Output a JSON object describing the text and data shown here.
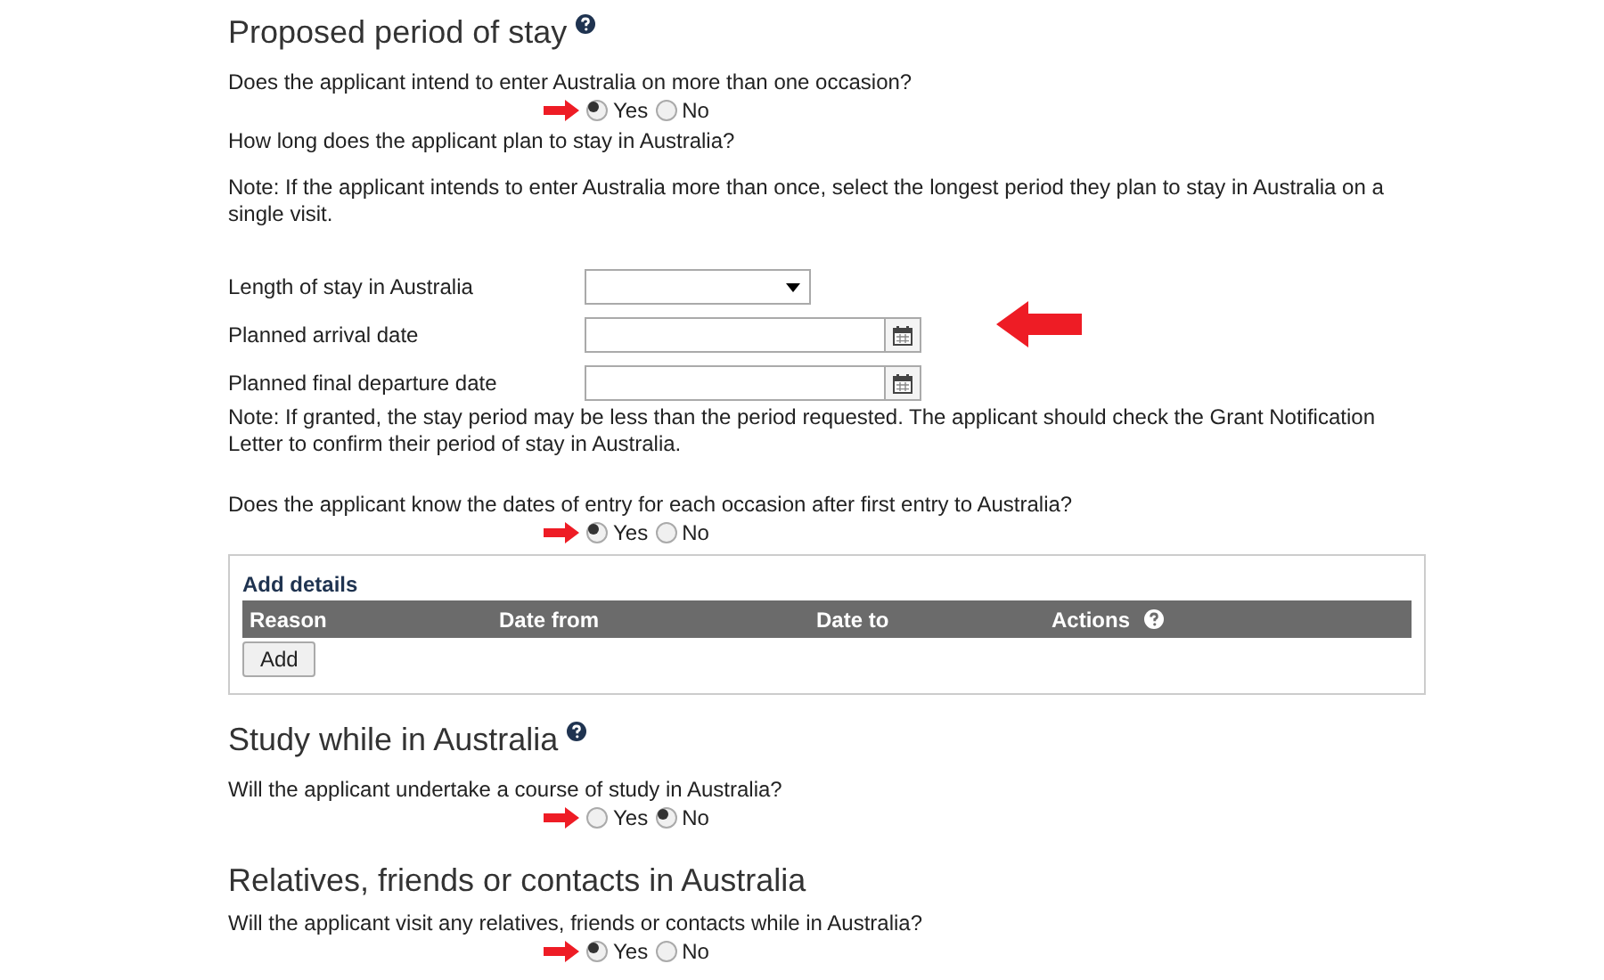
{
  "sections": [
    {
      "title": "Proposed period of stay",
      "help": true,
      "items": [
        {
          "kind": "question",
          "text": "Does the applicant intend to enter Australia on more than one occasion?"
        },
        {
          "kind": "radio",
          "options": [
            {
              "label": "Yes",
              "selected": true
            },
            {
              "label": "No",
              "selected": false
            }
          ]
        },
        {
          "kind": "question",
          "text": "How long does the applicant plan to stay in Australia?"
        },
        {
          "kind": "note",
          "text": "Note: If the applicant intends to enter Australia more than once, select the longest period they plan to stay in Australia on a single visit."
        },
        {
          "kind": "select",
          "label": "Length of stay in Australia"
        },
        {
          "kind": "date",
          "label": "Planned arrival date"
        },
        {
          "kind": "date",
          "label": "Planned final departure date"
        },
        {
          "kind": "tightnote",
          "text": "Note: If granted, the stay period may be less than the period requested. The applicant should check the Grant Notification Letter to confirm their period of stay in Australia."
        },
        {
          "kind": "question",
          "text": "Does the applicant know the dates of entry for each occasion after first entry to Australia?"
        },
        {
          "kind": "radio",
          "options": [
            {
              "label": "Yes",
              "selected": true
            },
            {
              "label": "No",
              "selected": false
            }
          ]
        },
        {
          "kind": "table",
          "title": "Add details",
          "columns": [
            "Reason",
            "Date from",
            "Date to",
            "Actions"
          ],
          "button": "Add"
        }
      ]
    },
    {
      "title": "Study while in Australia",
      "help": true,
      "items": [
        {
          "kind": "question",
          "text": "Will the applicant undertake a course of study in Australia?"
        },
        {
          "kind": "radio",
          "options": [
            {
              "label": "Yes",
              "selected": false
            },
            {
              "label": "No",
              "selected": true
            }
          ]
        }
      ]
    },
    {
      "title": "Relatives, friends or contacts in Australia",
      "help": false,
      "items": [
        {
          "kind": "question",
          "text": "Will the applicant visit any relatives, friends or contacts while in Australia?"
        },
        {
          "kind": "radio",
          "options": [
            {
              "label": "Yes",
              "selected": true
            },
            {
              "label": "No",
              "selected": false
            }
          ]
        }
      ]
    }
  ]
}
